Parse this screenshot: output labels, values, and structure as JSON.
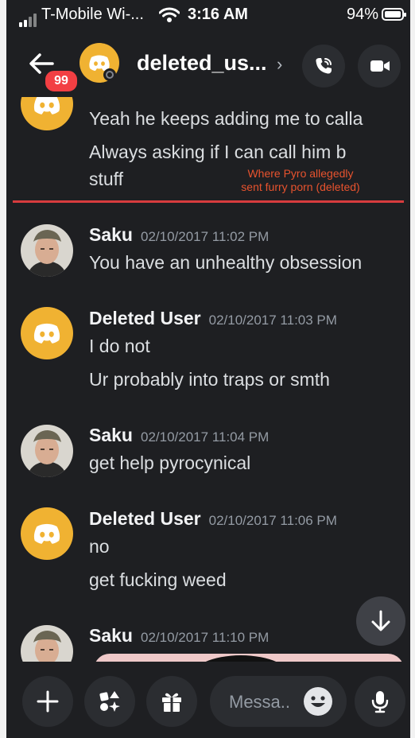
{
  "status_bar": {
    "carrier": "T-Mobile Wi-...",
    "time": "3:16 AM",
    "battery": "94%",
    "battery_level": 0.94
  },
  "header": {
    "back_badge": "99",
    "username": "deleted_us...",
    "chevron": "›",
    "icons": [
      "back-arrow-icon",
      "phone-call-icon",
      "video-camera-icon"
    ]
  },
  "messages": {
    "top_group": {
      "line1": "Yeah he keeps adding me to calla",
      "line2": "Always asking if I can call him b",
      "line3": "stuff"
    },
    "annotation": "Where Pyro allegedly sent furry porn (deleted)",
    "groups": [
      {
        "author": "Saku",
        "timestamp": "02/10/2017 11:02 PM",
        "lines": [
          "You have an unhealthy obsession"
        ]
      },
      {
        "author": "Deleted User",
        "timestamp": "02/10/2017 11:03 PM",
        "lines": [
          "I do not",
          "Ur probably into traps or smth"
        ]
      },
      {
        "author": "Saku",
        "timestamp": "02/10/2017 11:04 PM",
        "lines": [
          "get help pyrocynical"
        ]
      },
      {
        "author": "Deleted User",
        "timestamp": "02/10/2017 11:06 PM",
        "lines": [
          "no",
          "get fucking weed"
        ]
      },
      {
        "author": "Saku",
        "timestamp": "02/10/2017 11:10 PM",
        "lines": []
      }
    ]
  },
  "composer": {
    "placeholder": "Messa..",
    "icons": [
      "plus-icon",
      "apps-icon",
      "gift-icon",
      "emoji-icon",
      "microphone-icon"
    ]
  },
  "colors": {
    "background": "#1e1f22",
    "discord_avatar": "#f0b232",
    "mention_badge": "#f23f43",
    "annotation": "#e8532e"
  }
}
